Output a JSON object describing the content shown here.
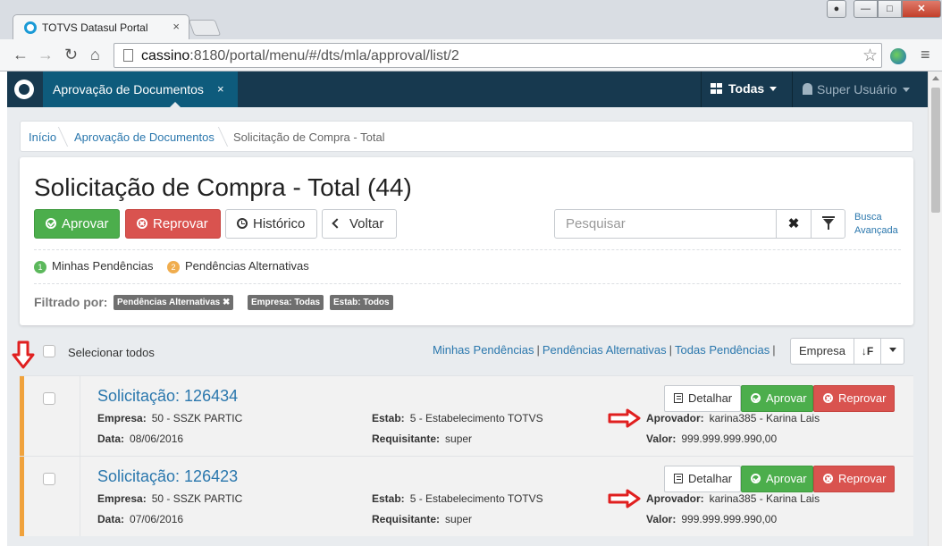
{
  "browser": {
    "tab_title": "TOTVS Datasul Portal",
    "tab_close": "×",
    "url_host": "cassino",
    "url_rest": ":8180/portal/menu/#/dts/mla/approval/list/2"
  },
  "appbar": {
    "tab_label": "Aprovação de Documentos",
    "tab_close": "×",
    "todas_label": "Todas",
    "user_label": "Super Usuário"
  },
  "breadcrumb": {
    "items": [
      "Início",
      "Aprovação de Documentos",
      "Solicitação de Compra - Total"
    ]
  },
  "header": {
    "title": "Solicitação de Compra - Total (44)",
    "buttons": {
      "aprovar": "Aprovar",
      "reprovar": "Reprovar",
      "historico": "Histórico",
      "voltar": "Voltar"
    },
    "search_placeholder": "Pesquisar",
    "clear_label": "✖",
    "busca_avancada_1": "Busca",
    "busca_avancada_2": "Avançada"
  },
  "legend": {
    "items": [
      {
        "number": "1",
        "label": "Minhas Pendências",
        "color": "#5cb85c"
      },
      {
        "number": "2",
        "label": "Pendências Alternativas",
        "color": "#f0ad4e"
      }
    ]
  },
  "filters": {
    "label": "Filtrado por:",
    "chips": [
      "Pendências Alternativas ✖",
      "Empresa: Todas",
      "Estab: Todos"
    ]
  },
  "list_header": {
    "select_all": "Selecionar todos",
    "links": [
      "Minhas Pendências",
      "Pendências Alternativas",
      "Todas Pendências"
    ],
    "link_sep": "|",
    "sort_by": "Empresa",
    "sort_icon": "↓F"
  },
  "card_actions": {
    "detalhar": "Detalhar",
    "aprovar": "Aprovar",
    "reprovar": "Reprovar"
  },
  "field_labels": {
    "empresa": "Empresa:",
    "data": "Data:",
    "estab": "Estab:",
    "requisitante": "Requisitante:",
    "aprovador": "Aprovador:",
    "valor": "Valor:"
  },
  "requests": [
    {
      "title": "Solicitação: 126434",
      "empresa": "50 - SSZK PARTIC",
      "data": "08/06/2016",
      "estab": "5 - Estabelecimento TOTVS",
      "requisitante": "super",
      "aprovador": "karina385 - Karina Lais",
      "valor": "999.999.999.990,00"
    },
    {
      "title": "Solicitação: 126423",
      "empresa": "50 - SSZK PARTIC",
      "data": "07/06/2016",
      "estab": "5 - Estabelecimento TOTVS",
      "requisitante": "super",
      "aprovador": "karina385 - Karina Lais",
      "valor": "999.999.999.990,00"
    }
  ],
  "colors": {
    "appbar": "#17394f",
    "active_tab": "#0e5b7c",
    "link": "#2a77ad",
    "approve": "#4cae4c",
    "reject": "#d9534f",
    "pending_bar": "#f0a23c",
    "annotation_arrow": "#e02020"
  }
}
